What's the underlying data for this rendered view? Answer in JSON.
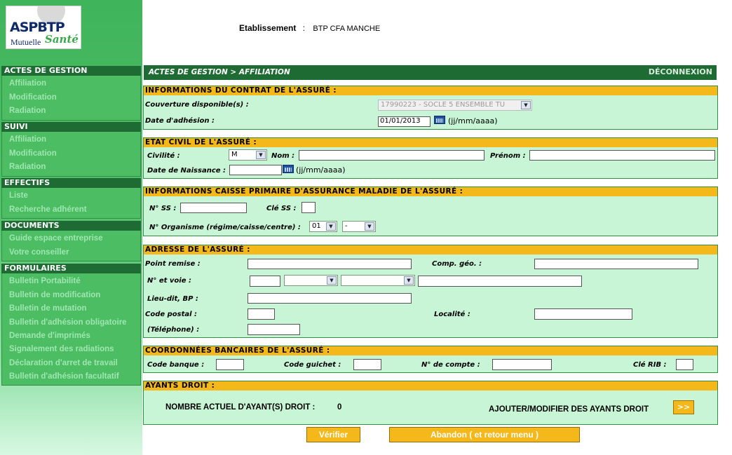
{
  "logo": {
    "brand": "ASPBTP",
    "sub1": "Mutuelle",
    "sub2": "Santé"
  },
  "etablissement": {
    "label": "Etablissement",
    "separator": ":",
    "value": "BTP CFA MANCHE"
  },
  "sidebar": {
    "sections": [
      {
        "title": "ACTES DE GESTION",
        "items": [
          "Affiliation",
          "Modification",
          "Radiation"
        ]
      },
      {
        "title": "SUIVI",
        "items": [
          "Affiliation",
          "Modification",
          "Radiation"
        ]
      },
      {
        "title": "EFFECTIFS",
        "items": [
          "Liste",
          "Recherche adhérent"
        ]
      },
      {
        "title": "DOCUMENTS",
        "items": [
          "Guide espace entreprise",
          "Votre conseiller"
        ]
      },
      {
        "title": "FORMULAIRES",
        "items": [
          "Bulletin Portabilité",
          "Bulletin de modification",
          "Bulletin de mutation",
          "Bulletin d'adhésion obligatoire",
          "Demande d'imprimés",
          "Signalement des radiations",
          "Déclaration d'arret de travail",
          "Bulletin d'adhésion facultatif"
        ]
      }
    ]
  },
  "topbar": {
    "breadcrumb": "ACTES DE GESTION  >  AFFILIATION",
    "logout": "DÉCONNEXION"
  },
  "contrat": {
    "title": "INFORMATIONS DU CONTRAT  DE L'ASSURÉ :",
    "couverture_label": "Couverture disponible(s) :",
    "couverture_value": "17990223 - SOCLE 5 ENSEMBLE TU",
    "date_label": "Date d'adhésion :",
    "date_value": "01/01/2013",
    "date_hint": "(jj/mm/aaaa)"
  },
  "etat_civil": {
    "title": "ETAT CIVIL  DE L'ASSURÉ :",
    "civilite_label": "Civilité :",
    "civilite_value": "M",
    "nom_label": "Nom :",
    "prenom_label": "Prénom :",
    "naissance_label": "Date de Naissance :",
    "naissance_hint": "(jj/mm/aaaa)"
  },
  "cpam": {
    "title": "INFORMATIONS CAISSE PRIMAIRE D'ASSURANCE MALADIE  DE L'ASSURÉ :",
    "nss_label": "N° SS :",
    "cle_label": "Clé SS :",
    "organisme_label": "N° Organisme (régime/caisse/centre) :",
    "regime_value": "01",
    "caisse_value": "-"
  },
  "adresse": {
    "title": "ADRESSE  DE L'ASSURÉ :",
    "point_remise_label": "Point remise  :",
    "comp_geo_label": "Comp. géo.  :",
    "voie_label": "N° et voie :",
    "lieu_dit_label": "Lieu-dit, BP :",
    "code_postal_label": "Code postal :",
    "localite_label": "Localité :",
    "telephone_label": "(Téléphone) :"
  },
  "bancaire": {
    "title": "COORDONNÉES BANCAIRES  DE L'ASSURÉ :",
    "code_banque_label": "Code banque :",
    "code_guichet_label": "Code guichet :",
    "compte_label": "N° de compte :",
    "cle_rib_label": "Clé RIB :"
  },
  "ayants": {
    "title": "AYANTS DROIT :",
    "count_label": "NOMBRE ACTUEL D'AYANT(S) DROIT :",
    "count_value": "0",
    "add_label": "AJOUTER/MODIFIER DES AYANTS DROIT",
    "go_label": ">>"
  },
  "buttons": {
    "verify": "Vérifier",
    "abandon": "Abandon ( et retour menu )"
  },
  "colors": {
    "dark_green": "#1e6b34",
    "section_bg": "#c8f5d6",
    "header_orange": "#f5b81a",
    "sidebar_green": "#4cbd63"
  }
}
